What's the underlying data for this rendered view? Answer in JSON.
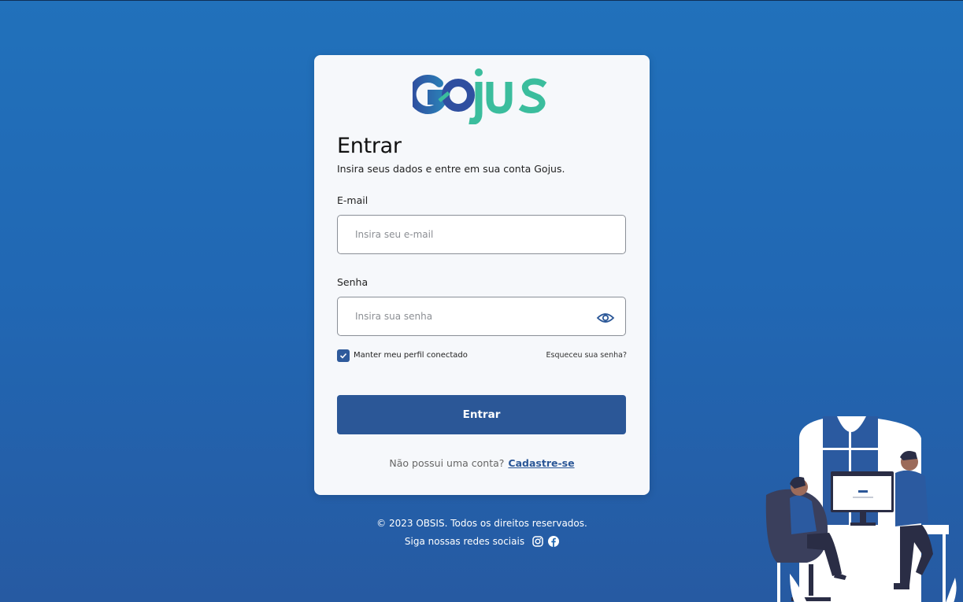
{
  "brand": {
    "logo_text_go": "GO",
    "logo_text_jus": "jus",
    "colors": {
      "go": "#2f5aa4",
      "jus": "#3bbd9d",
      "primary": "#2b5797"
    }
  },
  "login": {
    "title": "Entrar",
    "subtitle": "Insira seus dados e entre em sua conta Gojus.",
    "email_label": "E-mail",
    "email_placeholder": "Insira seu e-mail",
    "email_value": "",
    "password_label": "Senha",
    "password_placeholder": "Insira sua senha",
    "password_value": "",
    "password_toggle_icon": "eye-icon",
    "remember_label": "Manter meu perfil conectado",
    "remember_checked": true,
    "forgot_link": "Esqueceu sua senha?",
    "submit_label": "Entrar",
    "signup_prompt": "Não possui uma conta?",
    "signup_link": "Cadastre-se"
  },
  "footer": {
    "copyright": "© 2023 OBSIS. Todos os direitos reservados.",
    "social_label": "Siga nossas redes sociais",
    "social_icons": [
      "instagram-icon",
      "facebook-icon"
    ]
  }
}
